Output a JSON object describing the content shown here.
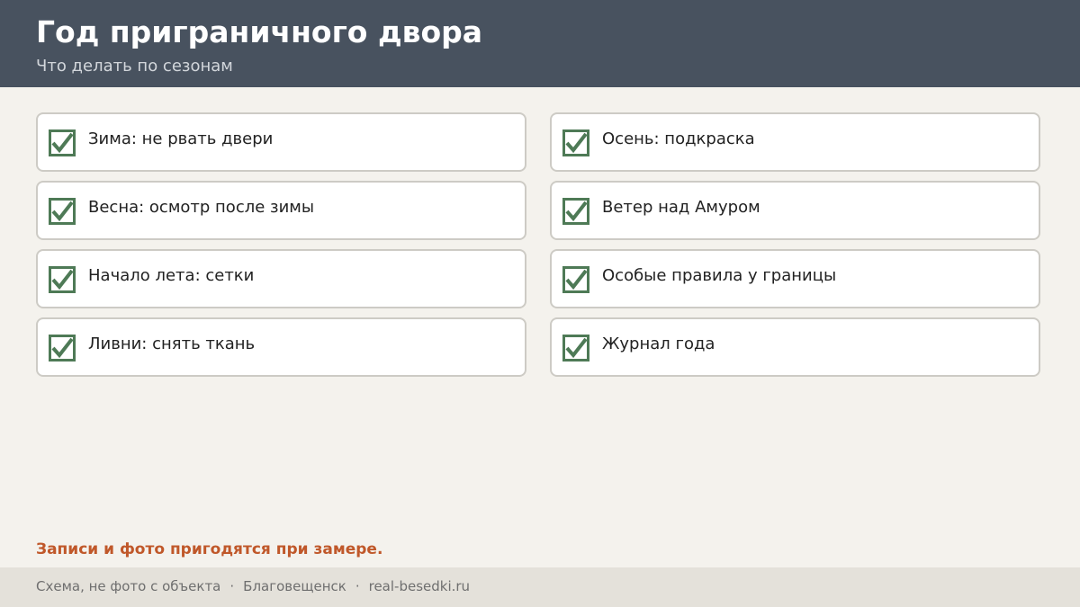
{
  "header": {
    "title": "Год приграничного двора",
    "subtitle": "Что делать по сезонам"
  },
  "checklist": {
    "left": [
      {
        "label": "Зима: не рвать двери",
        "checked": true
      },
      {
        "label": "Весна: осмотр после зимы",
        "checked": true
      },
      {
        "label": "Начало лета: сетки",
        "checked": true
      },
      {
        "label": "Ливни: снять ткань",
        "checked": true
      }
    ],
    "right": [
      {
        "label": "Осень: подкраска",
        "checked": true
      },
      {
        "label": "Ветер над Амуром",
        "checked": true
      },
      {
        "label": "Особые правила у границы",
        "checked": true
      },
      {
        "label": "Журнал года",
        "checked": true
      }
    ]
  },
  "note": "Записи и фото пригодятся при замере.",
  "footer": {
    "part1": "Схема, не фото с объекта",
    "separator": "·",
    "part2": "Благовещенск",
    "part3": "real-besedki.ru"
  },
  "colors": {
    "header_bg": "#48525f",
    "checkbox": "#4e7a56",
    "note": "#c0582a"
  },
  "icons": {
    "check": "checkbox-checked-icon"
  }
}
